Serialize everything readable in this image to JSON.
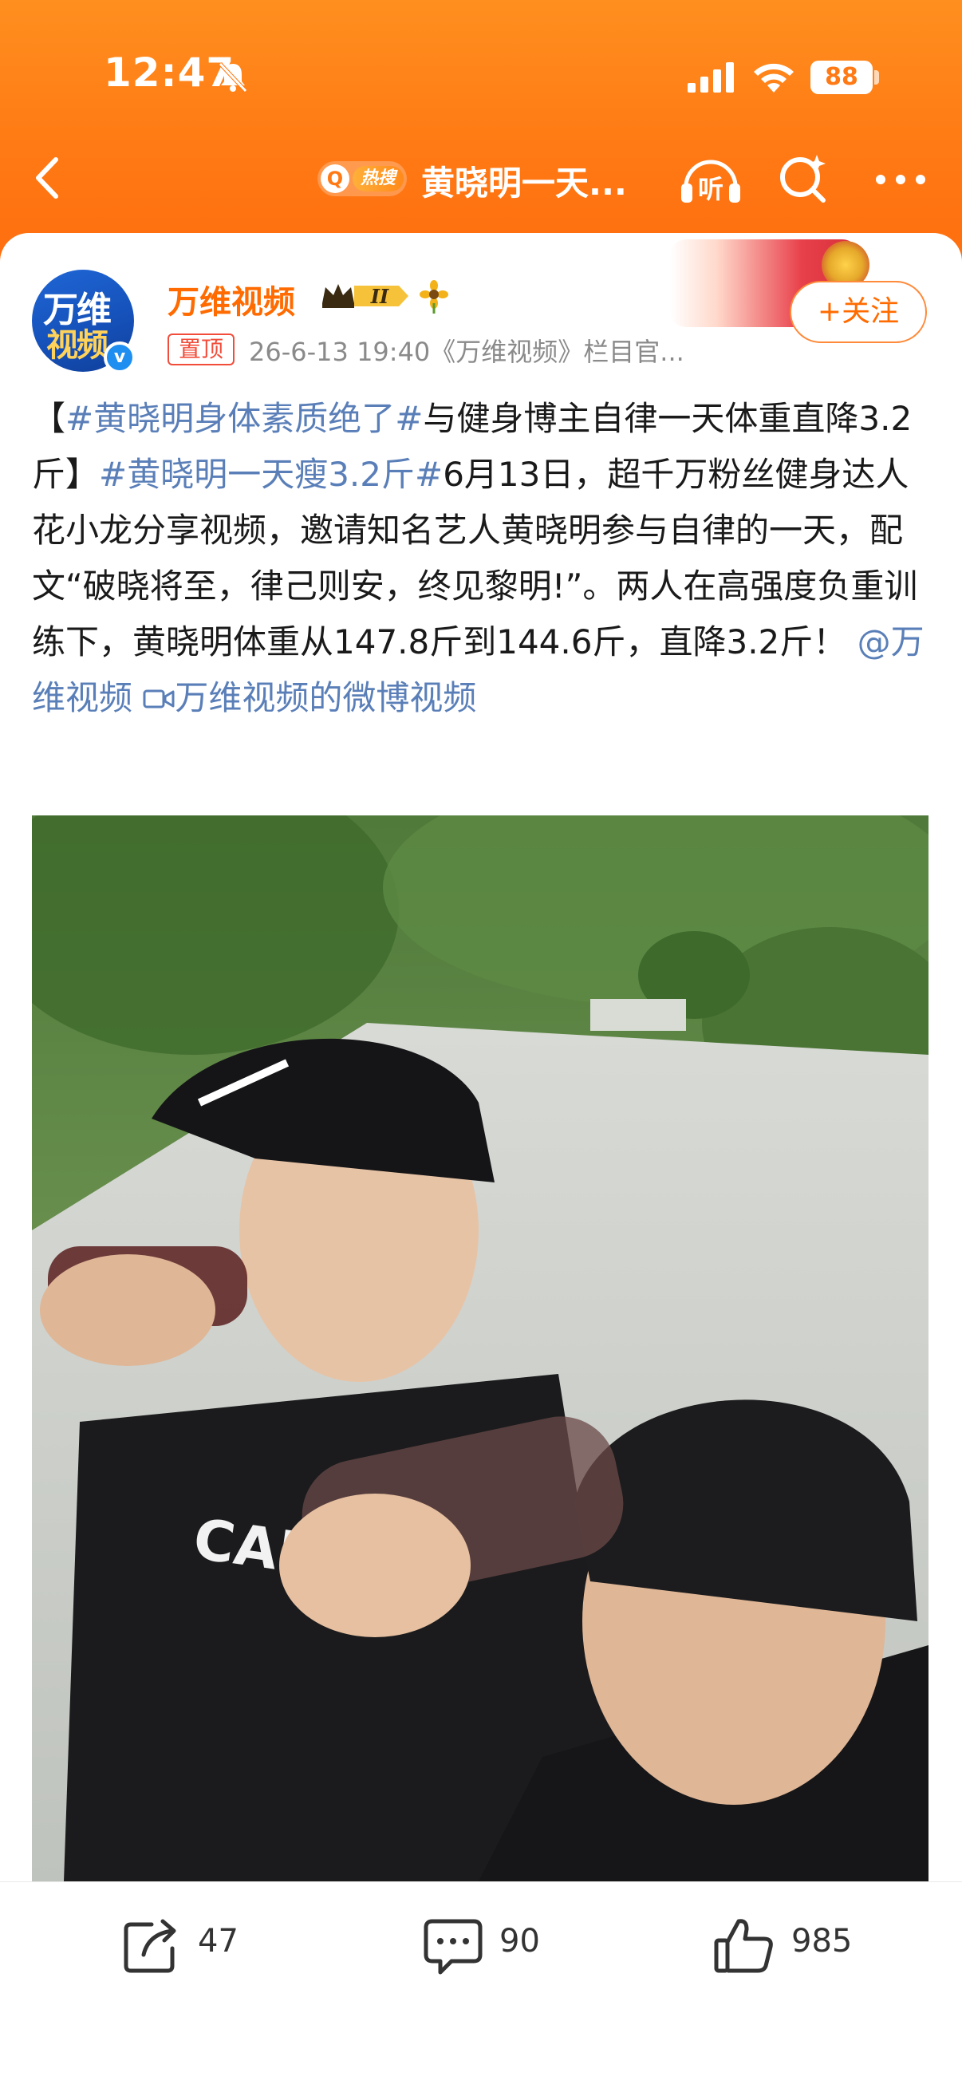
{
  "status_bar": {
    "time": "12:47",
    "battery": "88"
  },
  "nav": {
    "hot_search_label": "热搜",
    "title": "黄晓明一天..."
  },
  "post": {
    "author": {
      "name": "万维视频",
      "avatar_text_line1": "万维",
      "avatar_text_line2": "视频",
      "vip_level": "II"
    },
    "follow_label": "+关注",
    "pinned_label": "置顶",
    "meta": "26-6-13 19:40《万维视频》栏目官...",
    "text": {
      "bracket_open": "【",
      "hashtag_1": "#黄晓明身体素质绝了#",
      "part_1": "与健身博主自律一天体重直降3.2斤】",
      "hashtag_2": "#黄晓明一天瘦3.2斤#",
      "part_2": "6月13日，超千万粉丝健身达人花小龙分享视频，邀请知名艺人黄晓明参与自律的一天，配文“破晓将至，律己则安，终见黎明!”。两人在高强度负重训练下，黄晓明体重从147.8斤到144.6斤，直降3.2斤！",
      "mention": "@万维视频",
      "video_link": "万维视频的微博视频"
    }
  },
  "actions": {
    "share_count": "47",
    "comment_count": "90",
    "like_count": "985"
  },
  "colors": {
    "header_orange": "#ff7a14",
    "username_orange": "#ff6b00",
    "link_blue": "#5a7fb8",
    "pinned_red": "#f24c3a"
  }
}
